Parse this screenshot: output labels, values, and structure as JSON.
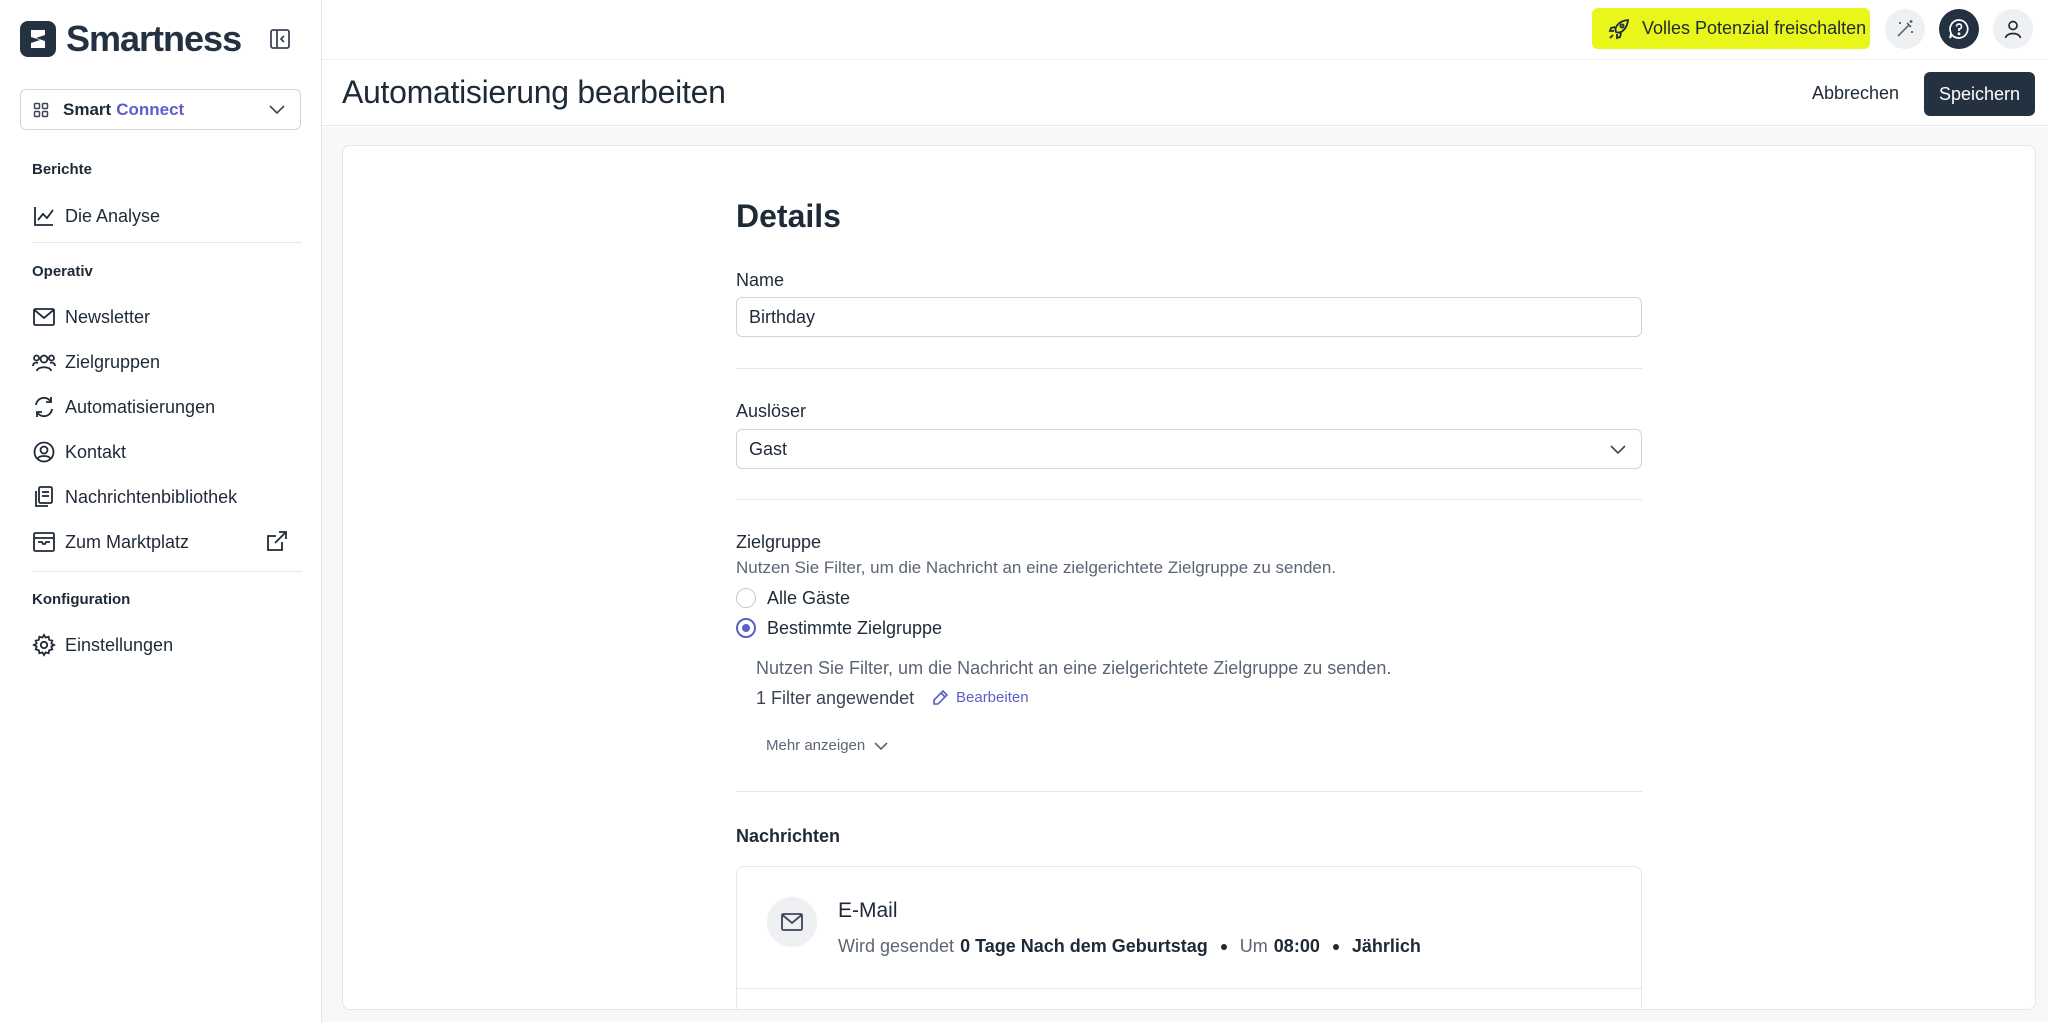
{
  "sidebar": {
    "brand": "Smartness",
    "product": {
      "prefix": "Smart",
      "suffix": "Connect"
    },
    "sections": [
      {
        "label": "Berichte"
      },
      {
        "label": "Operativ"
      },
      {
        "label": "Konfiguration"
      }
    ],
    "items": [
      {
        "label": "Die Analyse",
        "icon": "chart-line-icon"
      },
      {
        "label": "Newsletter",
        "icon": "mail-icon"
      },
      {
        "label": "Zielgruppen",
        "icon": "users-icon"
      },
      {
        "label": "Automatisierungen",
        "icon": "refresh-icon"
      },
      {
        "label": "Kontakt",
        "icon": "user-circle-icon"
      },
      {
        "label": "Nachrichtenbibliothek",
        "icon": "documents-icon"
      },
      {
        "label": "Zum Marktplatz",
        "icon": "archive-icon"
      },
      {
        "label": "Einstellungen",
        "icon": "gear-icon"
      }
    ]
  },
  "topbar": {
    "unlock_label": "Volles Potenzial freischalten",
    "accent": "#e8f61a"
  },
  "header": {
    "title": "Automatisierung bearbeiten",
    "cancel_label": "Abbrechen",
    "save_label": "Speichern"
  },
  "form": {
    "details_title": "Details",
    "name": {
      "label": "Name",
      "value": "Birthday"
    },
    "trigger": {
      "label": "Auslöser",
      "value": "Gast"
    },
    "audience": {
      "label": "Zielgruppe",
      "help": "Nutzen Sie Filter, um die Nachricht an eine zielgerichtete Zielgruppe zu senden.",
      "options": [
        {
          "label": "Alle Gäste",
          "checked": false
        },
        {
          "label": "Bestimmte Zielgruppe",
          "checked": true
        }
      ],
      "sub_help": "Nutzen Sie Filter, um die Nachricht an eine zielgerichtete Zielgruppe zu senden.",
      "filter_count": "1 Filter angewendet",
      "edit_label": "Bearbeiten",
      "show_more": "Mehr anzeigen"
    },
    "messages": {
      "label": "Nachrichten",
      "items": [
        {
          "title": "E-Mail",
          "sent_prefix": "Wird gesendet",
          "timing": "0 Tage Nach dem Geburtstag",
          "at_prefix": "Um",
          "time": "08:00",
          "frequency": "Jährlich"
        }
      ]
    }
  },
  "colors": {
    "primary": "#233140",
    "accent_purple": "#5b5fc7"
  }
}
